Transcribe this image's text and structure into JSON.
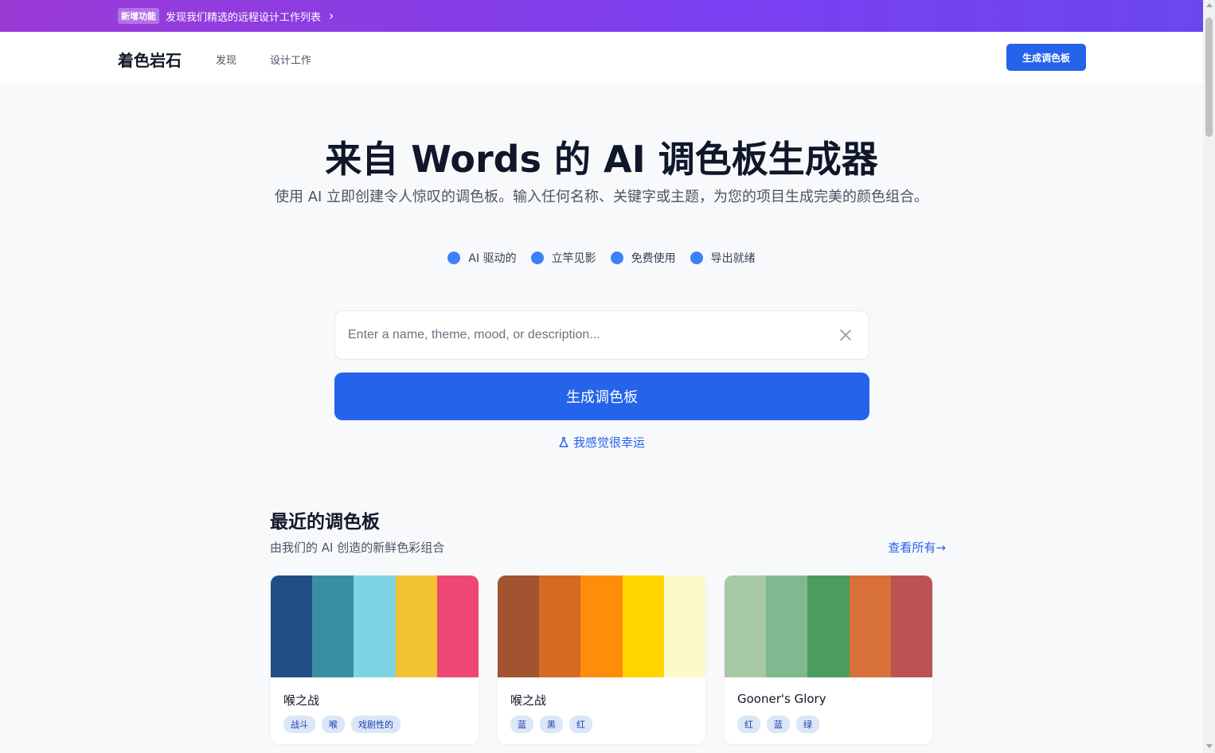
{
  "banner": {
    "badge": "新增功能",
    "text": "发现我们精选的远程设计工作列表",
    "chevron": "›"
  },
  "nav": {
    "logo": "着色岩石",
    "links": [
      "发现",
      "设计工作"
    ],
    "cta": "生成调色板"
  },
  "hero": {
    "title": "来自 Words 的 AI 调色板生成器",
    "subtitle": "使用 AI 立即创建令人惊叹的调色板。输入任何名称、关键字或主题，为您的项目生成完美的颜色组合。",
    "features": [
      "AI 驱动的",
      "立竿见影",
      "免费使用",
      "导出就绪"
    ]
  },
  "search": {
    "placeholder": "Enter a name, theme, mood, or description...",
    "value": ""
  },
  "generate_button": "生成调色板",
  "lucky_link": "我感觉很幸运",
  "recent": {
    "title": "最近的调色板",
    "subtitle": "由我们的 AI 创造的新鲜色彩组合",
    "view_all": "查看所有→",
    "cards": [
      {
        "name": "喉之战",
        "colors": [
          "#1f4e85",
          "#3a8ea3",
          "#7dd5e4",
          "#f3c232",
          "#ef4773"
        ],
        "tags": [
          "战斗",
          "喉",
          "戏剧性的"
        ]
      },
      {
        "name": "喉之战",
        "colors": [
          "#a2532f",
          "#d56a23",
          "#ff8c0a",
          "#ffd600",
          "#fdf9c9"
        ],
        "tags": [
          "蓝",
          "黑",
          "红"
        ]
      },
      {
        "name": "Gooner's Glory",
        "colors": [
          "#a7c9a5",
          "#7fb98f",
          "#4d9c5f",
          "#d8703a",
          "#bb5353"
        ],
        "tags": [
          "红",
          "蓝",
          "绿"
        ]
      }
    ]
  },
  "colors": {
    "accent": "#2563eb",
    "feature_dot": "#3b82f6",
    "banner_start": "#9b3bd6",
    "banner_end": "#6b46ee"
  }
}
